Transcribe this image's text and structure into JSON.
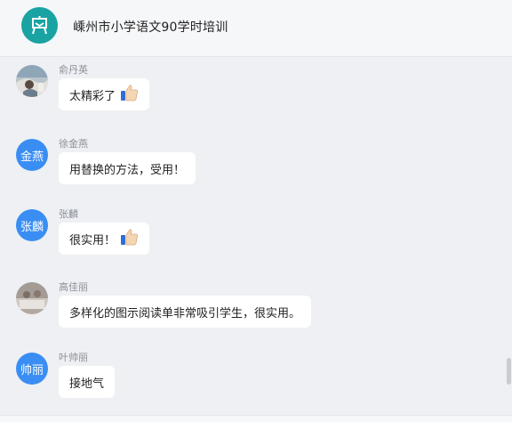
{
  "header": {
    "title": "嵊州市小学语文90学时培训"
  },
  "messages": [
    {
      "name": "俞丹英",
      "text": "太精彩了"
    },
    {
      "name": "徐金燕",
      "avatar_text": "金燕",
      "text": "用替换的方法，受用！"
    },
    {
      "name": "张麟",
      "avatar_text": "张麟",
      "text": "很实用！"
    },
    {
      "name": "高佳丽",
      "text": "多样化的图示阅读单非常吸引学生，很实用。"
    },
    {
      "name": "叶帅丽",
      "avatar_text": "帅丽",
      "text": "接地气"
    }
  ],
  "colors": {
    "logo": "#1aa3a3",
    "avatar": "#3a8ef3",
    "background": "#eef0f4"
  }
}
